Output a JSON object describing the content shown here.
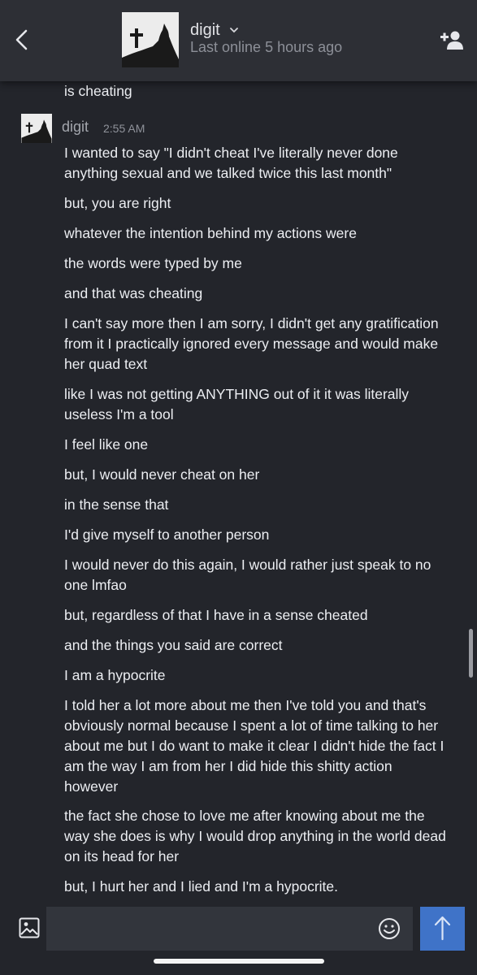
{
  "header": {
    "name": "digit",
    "status": "Last online 5 hours ago"
  },
  "sender": {
    "name": "digit",
    "time": "2:55 AM"
  },
  "messages": [
    "is cheating",
    "I wanted to say \"I didn't cheat I've literally never done anything sexual and we talked twice this last month\"",
    "but, you are right",
    "whatever the intention behind my actions were",
    "the words were typed by me",
    "and that was cheating",
    "I can't say more then I am sorry, I didn't get any gratification from it I practically ignored every message and would make her quad text",
    "like I was not getting ANYTHING out of it it was literally useless I'm a tool",
    "I feel like one",
    "but, I would never cheat on her",
    "in the sense that",
    "I'd give myself to another person",
    "I would never do this again, I would rather just speak to no one lmfao",
    "but, regardless of that I have in a sense cheated",
    "and the things you said are correct",
    "I am a hypocrite",
    "I told her a lot more about me then I've told you and that's obviously normal because I spent a lot of time talking to her about me but I do want to make it clear I didn't hide the fact I am the way I am from her I did hide this shitty action however",
    "the fact she chose to love me after knowing about me the way she does is why I would drop anything in the world dead on its head for her",
    "but, I hurt her and I lied and I'm a hypocrite."
  ],
  "composer": {
    "value": "",
    "placeholder": ""
  },
  "icons": {
    "back": "chevron-left-icon",
    "dropdown": "caret-down-icon",
    "add_friend": "add-friend-icon",
    "image": "image-icon",
    "emoji": "smiley-icon",
    "send": "arrow-up-icon"
  },
  "colors": {
    "background": "#23252b",
    "header": "#2d2f35",
    "input": "#32353c",
    "send_button": "#3f73c8",
    "muted_text": "#8d9098"
  }
}
